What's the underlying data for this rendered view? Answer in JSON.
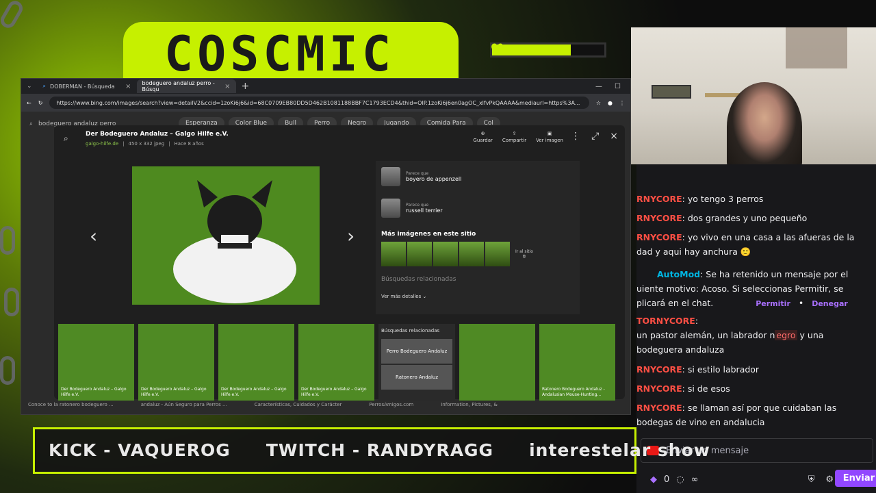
{
  "overlay_banner": {
    "title": "COSCMIC"
  },
  "browser": {
    "tabs": [
      {
        "label": "DOBERMAN - Búsqueda"
      },
      {
        "label": "bodeguero andaluz perro - Búsqu"
      }
    ],
    "url": "https://www.bing.com/images/search?view=detailV2&ccid=1zoKi6j6&id=68C0709EB80DD5D462B1081188BBF7C1793ECD4&thid=OIP.1zoKi6j6en0agOC_xlfvPkQAAAA&mediaurl=https%3A...",
    "search_query": "bodeguero andaluz perro",
    "chips": [
      "Esperanza",
      "Color Blue",
      "Bull",
      "Perro",
      "Negro",
      "Jugando",
      "Comida Para",
      "Col"
    ]
  },
  "detail": {
    "title": "Der Bodeguero Andaluz – Galgo Hilfe e.V.",
    "source": "galgo-hilfe.de",
    "size": "450 x 332 jpeg",
    "age": "Hace 8 años",
    "actions": {
      "save": "Guardar",
      "share": "Compartir",
      "view": "Ver imagen"
    },
    "lookalikes": [
      {
        "tag": "Parece que",
        "name": "boyero de appenzell"
      },
      {
        "tag": "Parece que",
        "name": "russell terrier"
      }
    ],
    "more_title": "Más imágenes en este sitio",
    "visit_site": "Ir al sitio",
    "related": "Búsquedas relacionadas",
    "see_more": "Ver más detalles"
  },
  "strip": {
    "cards": [
      {
        "caption": "Der Bodeguero Andaluz – Galgo Hilfe e.V."
      },
      {
        "caption": "Der Bodeguero Andaluz – Galgo Hilfe e.V."
      },
      {
        "caption": "Der Bodeguero Andaluz – Galgo Hilfe e.V."
      },
      {
        "caption": "Der Bodeguero Andaluz – Galgo Hilfe e.V."
      }
    ],
    "related_header": "Búsquedas relacionadas",
    "related_items": [
      "Perro Bodeguero Andaluz",
      "Ratonero Andaluz"
    ],
    "cards_right": [
      {
        "caption": ""
      },
      {
        "caption": "Ratonero Bodeguero Andaluz - Andalusian Mouse-Hunting..."
      }
    ]
  },
  "bg_captions": [
    "Conoce to la ratonero bodeguero ...",
    "andaluz - Aún Seguro para Perros ...",
    "Características, Cuidados y Carácter",
    "PerrosAmigos.com",
    "Information, Pictures, &"
  ],
  "chat": {
    "messages": [
      {
        "user": "RNYCORE",
        "text": ": yo tengo 3 perros"
      },
      {
        "user": "RNYCORE",
        "text": ": dos grandes y uno pequeño"
      },
      {
        "user": "RNYCORE",
        "text": ": yo vivo en una casa a las afueras de la"
      },
      {
        "user": "",
        "text": "dad y aqui hay anchura"
      }
    ],
    "mod": {
      "user": "AutoMod",
      "line1": ": Se ha retenido un mensaje por el",
      "line2": "uiente motivo: Acoso. Si seleccionas Permitir, se",
      "line3": "plicará en el chat.",
      "allow": "Permitir",
      "deny": "Denegar"
    },
    "held": {
      "user": "TORNYCORE",
      "pre": "un pastor alemán, un labrador n",
      "flag": "egro",
      "post": " y una",
      "line2": "bodeguera andaluza"
    },
    "after": [
      {
        "user": "RNYCORE",
        "text": ": si estilo labrador"
      },
      {
        "user": "RNYCORE",
        "text": ": si de esos"
      },
      {
        "user": "RNYCORE",
        "text": ": se llaman así por que cuidaban las"
      },
      {
        "user": "",
        "text": "bodegas de vino en andalucia"
      }
    ],
    "input_placeholder": "Enviar un mensaje",
    "points": "0",
    "send": "Enviar"
  },
  "ticker": [
    "KICK -  VAQUEROG",
    "TWITCH - RANDYRAGG",
    "interestelar show"
  ]
}
